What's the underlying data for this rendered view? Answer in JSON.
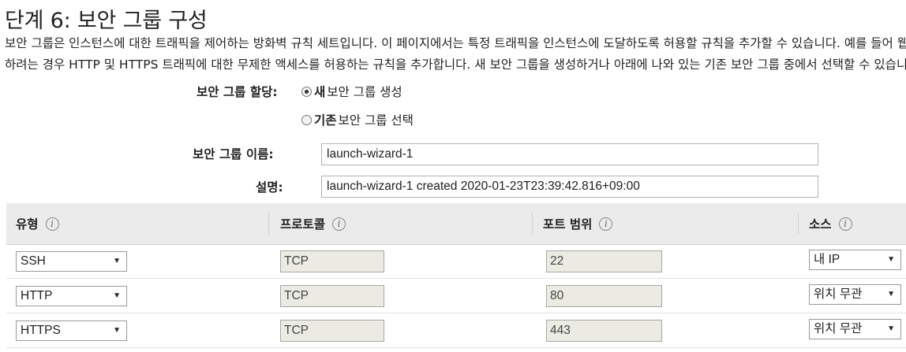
{
  "step_title": "단계 6: 보안 그룹 구성",
  "description": {
    "line1": "보안 그룹은 인스턴스에 대한 트래픽을 제어하는 방화벽 규칙 세트입니다. 이 페이지에서는 특정 트래픽을 인스턴스에 도달하도록 허용할 규칙을 추가할 수 있습니다. 예를 들어 웹 서버를 설정하고 인터넷 트래픽을 인스턴스에 도달하도록 허용",
    "line2": "하려는 경우 HTTP 및 HTTPS 트래픽에 대한 무제한 액세스를 허용하는 규칙을 추가합니다. 새 보안 그룹을 생성하거나 아래에 나와 있는 기존 보안 그룹 중에서 선택할 수 있습니다."
  },
  "assign": {
    "label": "보안 그룹 할당:",
    "options": [
      {
        "bold": "새",
        "rest": " 보안 그룹 생성",
        "selected": true
      },
      {
        "bold": "기존",
        "rest": " 보안 그룹 선택",
        "selected": false
      }
    ]
  },
  "name_field": {
    "label": "보안 그룹 이름:",
    "value": "launch-wizard-1"
  },
  "desc_field": {
    "label": "설명:",
    "value": "launch-wizard-1 created 2020-01-23T23:39:42.816+09:00"
  },
  "table": {
    "headers": [
      "유형",
      "프로토콜",
      "포트 범위",
      "소스"
    ],
    "info_glyph": "i",
    "rows": [
      {
        "type": "SSH",
        "protocol": "TCP",
        "port": "22",
        "source": "내 IP"
      },
      {
        "type": "HTTP",
        "protocol": "TCP",
        "port": "80",
        "source": "위치 무관"
      },
      {
        "type": "HTTPS",
        "protocol": "TCP",
        "port": "443",
        "source": "위치 무관"
      }
    ],
    "dropdown_glyph": "▼"
  }
}
